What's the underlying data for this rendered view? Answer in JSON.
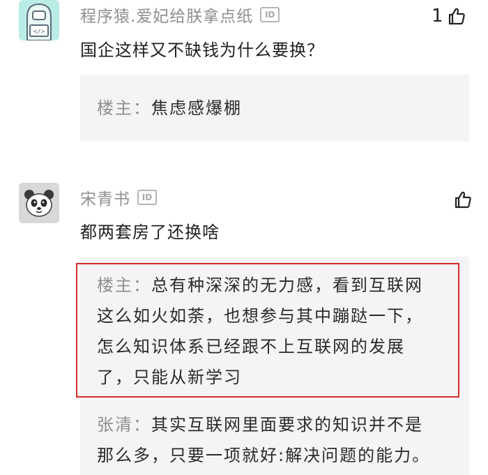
{
  "comments": [
    {
      "username": "程序猿.爱妃给朕拿点纸",
      "id_badge": "ID",
      "text": "国企这样又不缺钱为什么要换？",
      "likes": "1",
      "avatar_icon": "coder-avatar-icon",
      "replies": [
        {
          "author": "楼主：",
          "lines": [
            "焦虑感爆棚"
          ]
        }
      ]
    },
    {
      "username": "宋青书",
      "id_badge": "ID",
      "text": "都两套房了还换啥",
      "likes": "",
      "avatar_icon": "panda-avatar-icon",
      "replies": [
        {
          "author": "楼主：",
          "lines": [
            "总有种深深的无力感，看到互联网",
            "这么如火如荼，也想参与其中蹦跶一下，",
            "怎么知识体系已经跟不上互联网的发展",
            "了，只能从新学习"
          ]
        },
        {
          "author": "张清：",
          "lines": [
            "其实互联网里面要求的知识并不是",
            "那么多，只要一项就好:解决问题的能力。"
          ]
        }
      ]
    }
  ],
  "colors": {
    "highlight_border": "#d62a2a",
    "reply_bg": "#f4f4f6",
    "username": "#8f8f8f"
  }
}
